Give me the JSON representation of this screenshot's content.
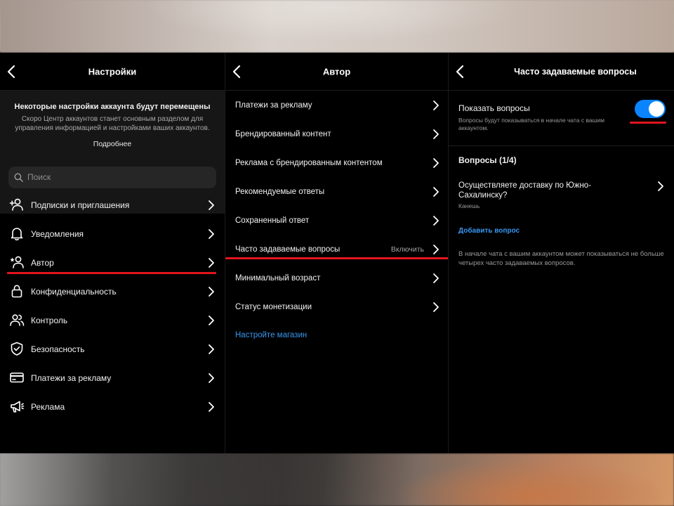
{
  "colors": {
    "accent_blue": "#3897f0",
    "toggle_on": "#0a84ff",
    "highlight_red": "#e3151d",
    "panel_bg": "#000000"
  },
  "settings_panel": {
    "title": "Настройки",
    "notice": {
      "title": "Некоторые настройки аккаунта будут перемещены",
      "text": "Скоро Центр аккаунтов станет основным разделом для управления информацией и настройками ваших аккаунтов.",
      "link": "Подробнее"
    },
    "search_placeholder": "Поиск",
    "items": [
      {
        "label": "Подписки и приглашения",
        "icon": "add-person-icon"
      },
      {
        "label": "Уведомления",
        "icon": "bell-icon"
      },
      {
        "label": "Автор",
        "icon": "star-person-icon"
      },
      {
        "label": "Конфиденциальность",
        "icon": "lock-icon"
      },
      {
        "label": "Контроль",
        "icon": "people-icon"
      },
      {
        "label": "Безопасность",
        "icon": "shield-check-icon"
      },
      {
        "label": "Платежи за рекламу",
        "icon": "card-icon"
      },
      {
        "label": "Реклама",
        "icon": "megaphone-icon"
      }
    ]
  },
  "author_panel": {
    "title": "Автор",
    "items": [
      {
        "label": "Платежи за рекламу"
      },
      {
        "label": "Брендированный контент"
      },
      {
        "label": "Реклама с брендированным контентом"
      },
      {
        "label": "Рекомендуемые ответы"
      },
      {
        "label": "Сохраненный ответ"
      },
      {
        "label": "Часто задаваемые вопросы",
        "value": "Включить"
      },
      {
        "label": "Минимальный возраст"
      },
      {
        "label": "Статус монетизации"
      }
    ],
    "shop_link": "Настройте магазин"
  },
  "faq_panel": {
    "title": "Часто задаваемые вопросы",
    "show_questions_label": "Показать вопросы",
    "show_questions_sub": "Вопросы будут показываться в начале чата с вашим аккаунтом.",
    "toggle_on": true,
    "questions_header": "Вопросы (1/4)",
    "question": {
      "text": "Осуществляете доставку по Южно-Сахалинску?",
      "sub": "Канешь"
    },
    "add_question": "Добавить вопрос",
    "info": "В начале чата с вашим аккаунтом может показываться не больше четырех часто задаваемых вопросов."
  }
}
